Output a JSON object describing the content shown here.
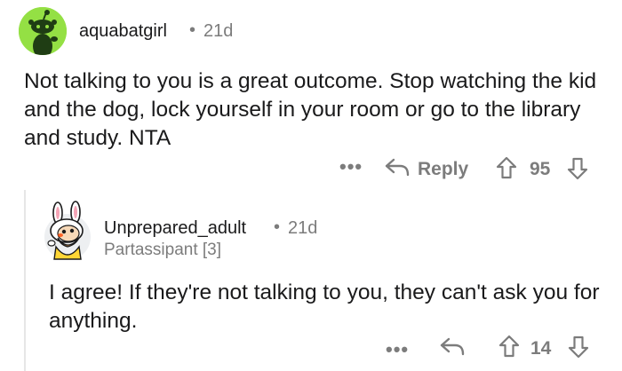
{
  "comment": {
    "username": "aquabatgirl",
    "separator": "•",
    "age": "21d",
    "body": "Not talking to you is a great outcome. Stop watching the kid and the dog, lock yourself in your room or go to the library and study. NTA",
    "actions": {
      "more_label": "•••",
      "reply_label": "Reply",
      "upvote_icon": "upvote-arrow-icon",
      "downvote_icon": "downvote-arrow-icon",
      "score": "95"
    },
    "avatar_color": "#94e044"
  },
  "reply": {
    "username": "Unprepared_adult",
    "separator": "•",
    "age": "21d",
    "flair": "Partassipant [3]",
    "body": "I agree! If they're not talking to you, they can't ask you for anything.",
    "actions": {
      "more_label": "•••",
      "reply_icon": "reply-arrow-icon",
      "upvote_icon": "upvote-arrow-icon",
      "downvote_icon": "downvote-arrow-icon",
      "score": "14"
    }
  },
  "colors": {
    "text": "#1a1a1b",
    "meta": "#7c7c7c",
    "thread_line": "#e6e6e6"
  }
}
